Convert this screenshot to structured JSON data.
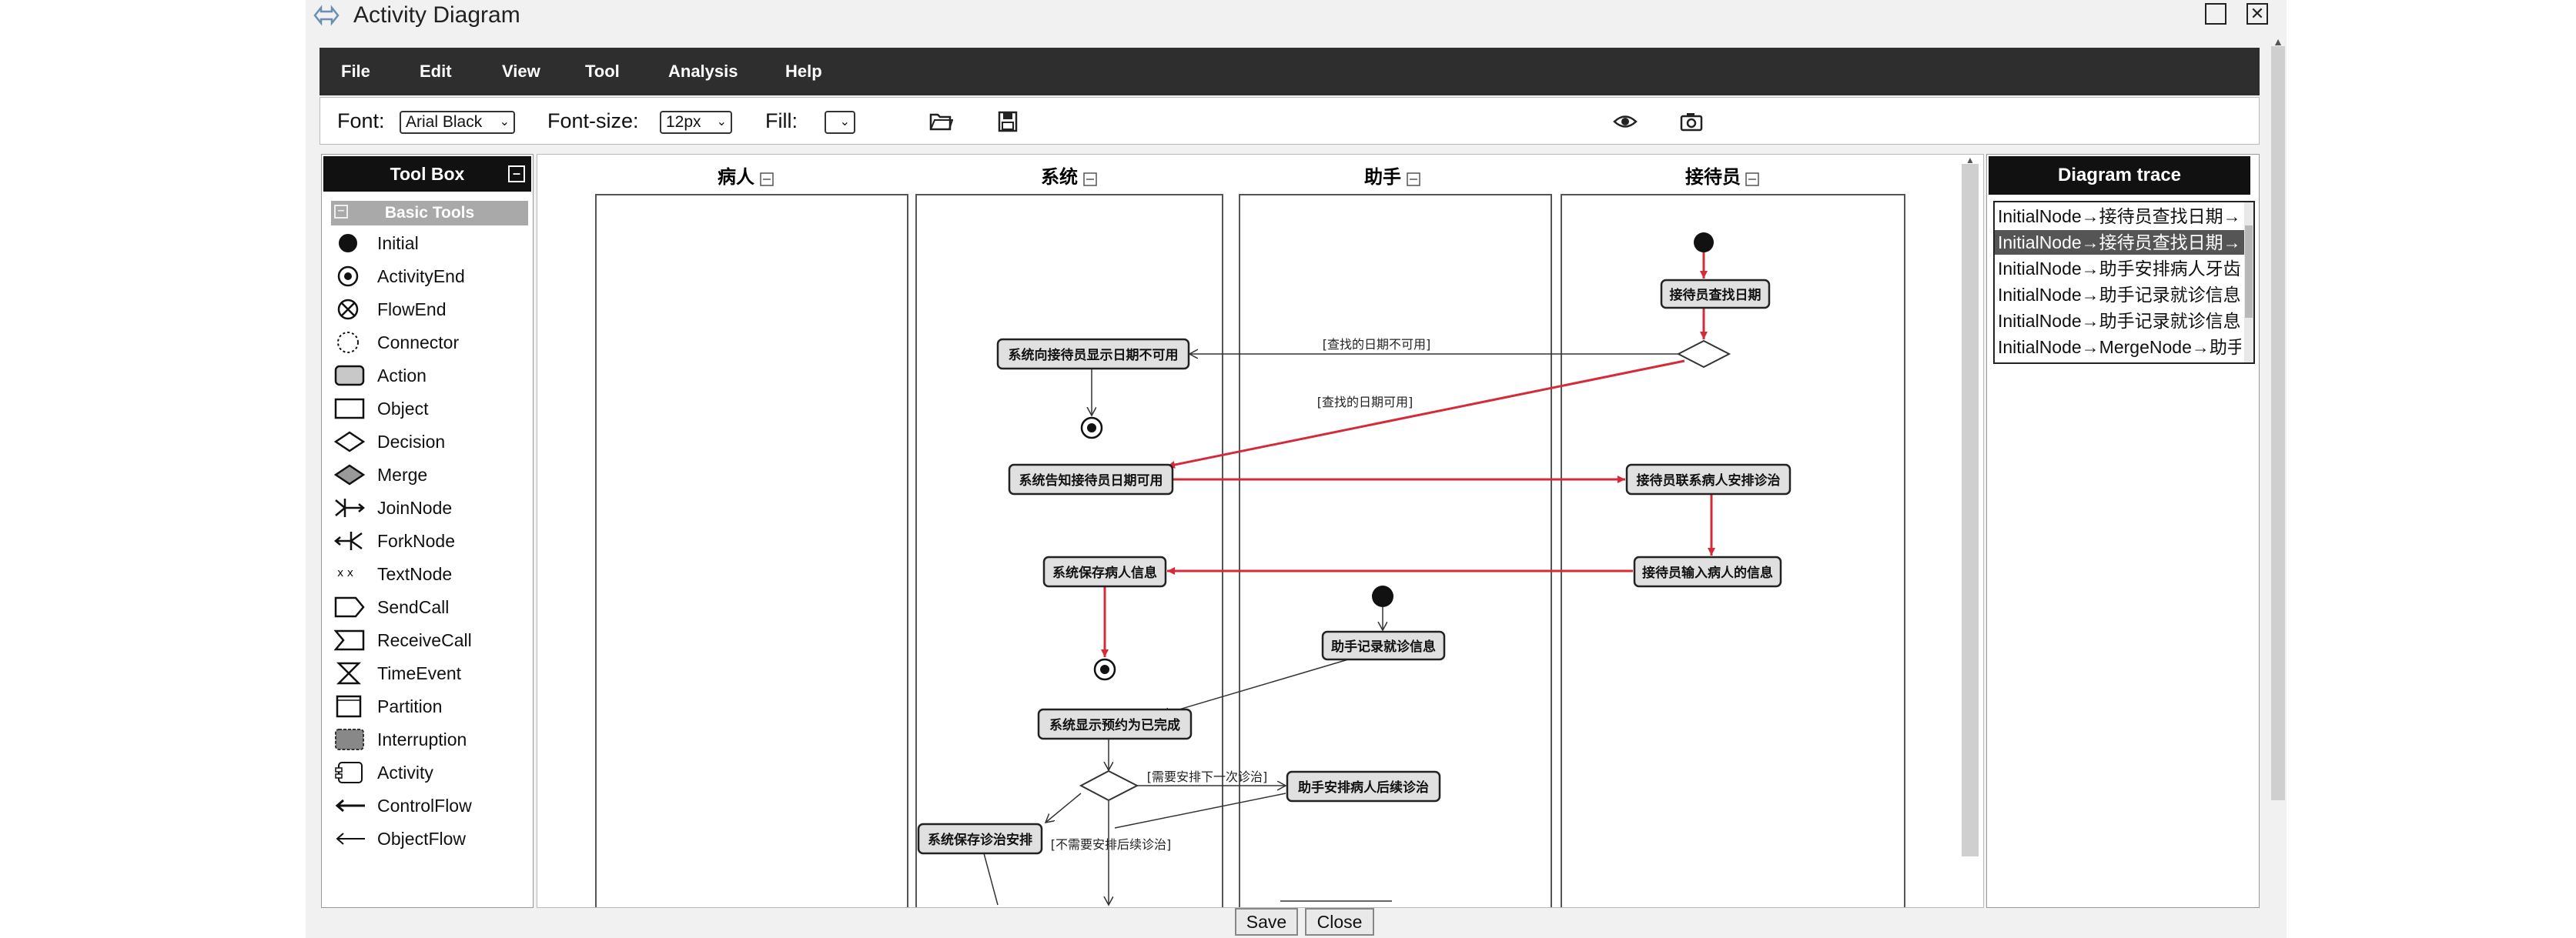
{
  "window": {
    "title": "Activity Diagram"
  },
  "menu": [
    "File",
    "Edit",
    "View",
    "Tool",
    "Analysis",
    "Help"
  ],
  "toolbar": {
    "font_label": "Font:",
    "font_value": "Arial Black",
    "fontsize_label": "Font-size:",
    "fontsize_value": "12px",
    "fill_label": "Fill:",
    "fill_value": ""
  },
  "toolbox": {
    "title": "Tool Box",
    "section": "Basic Tools",
    "items": [
      "Initial",
      "ActivityEnd",
      "FlowEnd",
      "Connector",
      "Action",
      "Object",
      "Decision",
      "Merge",
      "JoinNode",
      "ForkNode",
      "TextNode",
      "SendCall",
      "ReceiveCall",
      "TimeEvent",
      "Partition",
      "Interruption",
      "Activity",
      "ControlFlow",
      "ObjectFlow"
    ]
  },
  "diagram": {
    "lanes": [
      "病人",
      "系统",
      "助手",
      "接待员"
    ],
    "actions": {
      "a1": "接待员查找日期",
      "a2": "系统向接待员显示日期不可用",
      "a3": "系统告知接待员日期可用",
      "a4": "接待员联系病人安排诊治",
      "a5": "接待员输入病人的信息",
      "a6": "系统保存病人信息",
      "a7": "助手记录就诊信息",
      "a8": "系统显示预约为已完成",
      "a9": "助手安排病人后续诊治",
      "a10": "系统保存诊治安排"
    },
    "guards": {
      "g1": "[查找的日期不可用]",
      "g2": "[查找的日期可用]",
      "g3": "[需要安排下一次诊治]",
      "g4": "[不需要安排后续诊治]"
    }
  },
  "trace": {
    "title": "Diagram trace",
    "items": [
      "InitialNode→接待员查找日期→",
      "InitialNode→接待员查找日期→",
      "InitialNode→助手安排病人牙齿",
      "InitialNode→助手记录就诊信息",
      "InitialNode→助手记录就诊信息",
      "InitialNode→MergeNode→助手"
    ],
    "selected_index": 1
  },
  "buttons": {
    "save": "Save",
    "close": "Close"
  },
  "colors": {
    "dark_bar": "#2e2e2e",
    "highlight_flow": "#d42a3a",
    "selected_row": "#555555"
  }
}
